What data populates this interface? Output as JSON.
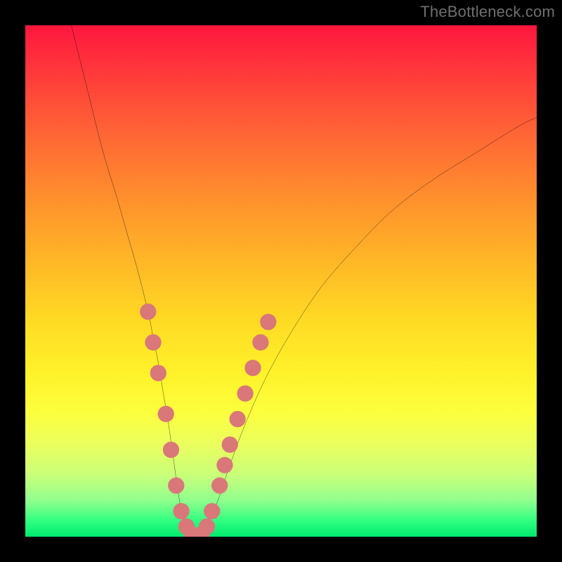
{
  "watermark": "TheBottleneck.com",
  "chart_data": {
    "type": "line",
    "title": "",
    "xlabel": "",
    "ylabel": "",
    "xlim": [
      0,
      100
    ],
    "ylim": [
      0,
      100
    ],
    "grid": false,
    "legend": false,
    "series": [
      {
        "name": "bottleneck-curve",
        "x": [
          9,
          12,
          15,
          18,
          20,
          22,
          24,
          25,
          26,
          27,
          28,
          29,
          30,
          31,
          32,
          33,
          34,
          35,
          36,
          38,
          40,
          43,
          47,
          52,
          58,
          65,
          72,
          80,
          88,
          96,
          100
        ],
        "values": [
          100,
          88,
          76,
          66,
          59,
          52,
          44,
          39,
          34,
          28,
          22,
          15,
          8,
          3,
          1,
          0,
          0,
          1,
          3,
          8,
          14,
          22,
          31,
          40,
          49,
          57,
          64,
          70,
          75,
          80,
          82
        ]
      }
    ],
    "markers": [
      {
        "x": 24.0,
        "y": 44
      },
      {
        "x": 25.0,
        "y": 38
      },
      {
        "x": 26.0,
        "y": 32
      },
      {
        "x": 27.5,
        "y": 24
      },
      {
        "x": 28.5,
        "y": 17
      },
      {
        "x": 29.5,
        "y": 10
      },
      {
        "x": 30.5,
        "y": 5
      },
      {
        "x": 31.5,
        "y": 2
      },
      {
        "x": 32.5,
        "y": 0.5
      },
      {
        "x": 33.5,
        "y": 0.2
      },
      {
        "x": 34.5,
        "y": 0.5
      },
      {
        "x": 35.5,
        "y": 2
      },
      {
        "x": 36.5,
        "y": 5
      },
      {
        "x": 38.0,
        "y": 10
      },
      {
        "x": 39.0,
        "y": 14
      },
      {
        "x": 40.0,
        "y": 18
      },
      {
        "x": 41.5,
        "y": 23
      },
      {
        "x": 43.0,
        "y": 28
      },
      {
        "x": 44.5,
        "y": 33
      },
      {
        "x": 46.0,
        "y": 38
      },
      {
        "x": 47.5,
        "y": 42
      }
    ],
    "marker_style": {
      "color": "#d97779",
      "radius_frac": 0.016
    },
    "gradient_stops": [
      {
        "pos": 0.0,
        "color": "#fe163e"
      },
      {
        "pos": 0.2,
        "color": "#ff5a37"
      },
      {
        "pos": 0.45,
        "color": "#ffb327"
      },
      {
        "pos": 0.68,
        "color": "#fff22a"
      },
      {
        "pos": 0.88,
        "color": "#c9ff7a"
      },
      {
        "pos": 1.0,
        "color": "#00e86e"
      }
    ]
  }
}
